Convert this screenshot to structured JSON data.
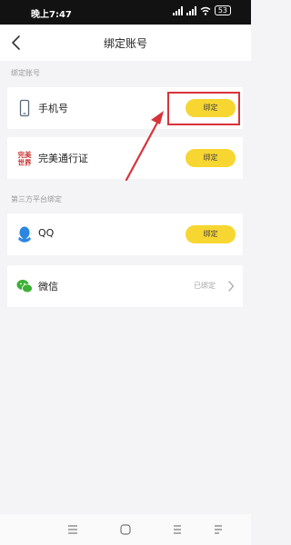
{
  "status_bar": {
    "time": "晚上7:47",
    "battery": "53"
  },
  "header": {
    "title": "绑定账号"
  },
  "sections": {
    "accounts_label": "绑定账号",
    "third_party_label": "第三方平台绑定"
  },
  "rows": {
    "phone": {
      "label": "手机号",
      "button": "绑定",
      "icon": "phone-icon"
    },
    "perfect": {
      "label": "完美通行证",
      "button": "绑定",
      "icon": "perfect-world-logo",
      "logo_text": "完美世界"
    },
    "qq": {
      "label": "QQ",
      "button": "绑定",
      "icon": "qq-icon"
    },
    "wechat": {
      "label": "微信",
      "status": "已绑定",
      "icon": "wechat-icon"
    }
  },
  "colors": {
    "accent": "#f7d631",
    "highlight": "#d8333b",
    "qq": "#2a86e0",
    "wechat": "#3cb034",
    "perfect": "#c8302e"
  }
}
